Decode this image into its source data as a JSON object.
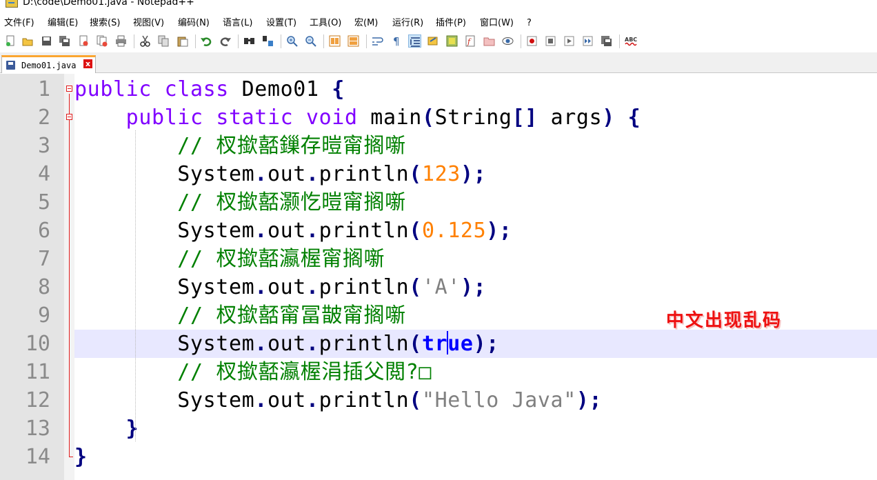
{
  "window": {
    "title": "D:\\code\\Demo01.java - Notepad++"
  },
  "menu": [
    "文件(F)",
    "编辑(E)",
    "搜索(S)",
    "视图(V)",
    "编码(N)",
    "语言(L)",
    "设置(T)",
    "工具(O)",
    "宏(M)",
    "运行(R)",
    "插件(P)",
    "窗口(W)",
    "?"
  ],
  "toolbar": {
    "icons": [
      "new-file-icon",
      "open-file-icon",
      "save-icon",
      "save-all-icon",
      "close-icon",
      "close-all-icon",
      "print-icon",
      "cut-icon",
      "copy-icon",
      "paste-icon",
      "undo-icon",
      "redo-icon",
      "find-icon",
      "replace-icon",
      "zoom-in-icon",
      "zoom-out-icon",
      "sync-vertical-icon",
      "sync-horizontal-icon",
      "word-wrap-icon",
      "show-all-chars-icon",
      "indent-guide-icon",
      "user-lang-icon",
      "doc-map-icon",
      "function-list-icon",
      "folder-workspace-icon",
      "monitor-icon",
      "record-macro-icon",
      "stop-macro-icon",
      "play-macro-icon",
      "run-macro-multiple-icon",
      "save-macro-icon",
      "spellcheck-icon"
    ],
    "spellcheck_label": "ABC"
  },
  "tabs": [
    {
      "label": "Demo01.java",
      "close": "x"
    }
  ],
  "editor": {
    "line_numbers": [
      "1",
      "2",
      "3",
      "4",
      "5",
      "6",
      "7",
      "8",
      "9",
      "10",
      "11",
      "12",
      "13",
      "14"
    ],
    "lines": [
      {
        "indent": "",
        "tokens": [
          {
            "t": "public",
            "c": "kw"
          },
          {
            "t": " "
          },
          {
            "t": "class",
            "c": "kw"
          },
          {
            "t": " Demo01 "
          },
          {
            "t": "{",
            "c": "op"
          }
        ]
      },
      {
        "indent": "    ",
        "tokens": [
          {
            "t": "public",
            "c": "kw"
          },
          {
            "t": " "
          },
          {
            "t": "static",
            "c": "kw"
          },
          {
            "t": " "
          },
          {
            "t": "void",
            "c": "kw"
          },
          {
            "t": " main"
          },
          {
            "t": "(",
            "c": "op"
          },
          {
            "t": "String"
          },
          {
            "t": "[]",
            "c": "op"
          },
          {
            "t": " args"
          },
          {
            "t": ")",
            "c": "op"
          },
          {
            "t": " "
          },
          {
            "t": "{",
            "c": "op"
          }
        ]
      },
      {
        "indent": "        ",
        "tokens": [
          {
            "t": "// 杈撳嚭鏁存暟甯搁噺",
            "c": "cm"
          }
        ]
      },
      {
        "indent": "        ",
        "tokens": [
          {
            "t": "System"
          },
          {
            "t": ".",
            "c": "op"
          },
          {
            "t": "out"
          },
          {
            "t": ".",
            "c": "op"
          },
          {
            "t": "println"
          },
          {
            "t": "(",
            "c": "op"
          },
          {
            "t": "123",
            "c": "num"
          },
          {
            "t": ");",
            "c": "op"
          }
        ]
      },
      {
        "indent": "        ",
        "tokens": [
          {
            "t": "// 杈撳嚭灏忔暟甯搁噺",
            "c": "cm"
          }
        ]
      },
      {
        "indent": "        ",
        "tokens": [
          {
            "t": "System"
          },
          {
            "t": ".",
            "c": "op"
          },
          {
            "t": "out"
          },
          {
            "t": ".",
            "c": "op"
          },
          {
            "t": "println"
          },
          {
            "t": "(",
            "c": "op"
          },
          {
            "t": "0.125",
            "c": "num"
          },
          {
            "t": ");",
            "c": "op"
          }
        ]
      },
      {
        "indent": "        ",
        "tokens": [
          {
            "t": "// 杈撳嚭瀛楃甯搁噺",
            "c": "cm"
          }
        ]
      },
      {
        "indent": "        ",
        "tokens": [
          {
            "t": "System"
          },
          {
            "t": ".",
            "c": "op"
          },
          {
            "t": "out"
          },
          {
            "t": ".",
            "c": "op"
          },
          {
            "t": "println"
          },
          {
            "t": "(",
            "c": "op"
          },
          {
            "t": "'A'",
            "c": "str"
          },
          {
            "t": ");",
            "c": "op"
          }
        ]
      },
      {
        "indent": "        ",
        "tokens": [
          {
            "t": "// 杈撳嚭甯冨皵甯搁噺",
            "c": "cm"
          }
        ]
      },
      {
        "indent": "        ",
        "current": true,
        "tokens": [
          {
            "t": "System"
          },
          {
            "t": ".",
            "c": "op"
          },
          {
            "t": "out"
          },
          {
            "t": ".",
            "c": "op"
          },
          {
            "t": "println"
          },
          {
            "t": "(",
            "c": "op"
          },
          {
            "t": "tr",
            "c": "kw2"
          },
          {
            "caret": true
          },
          {
            "t": "ue",
            "c": "kw2"
          },
          {
            "t": ");",
            "c": "op"
          }
        ]
      },
      {
        "indent": "        ",
        "tokens": [
          {
            "t": "// 杈撳嚭瀛楃涓插父閲?□",
            "c": "cm"
          }
        ]
      },
      {
        "indent": "        ",
        "tokens": [
          {
            "t": "System"
          },
          {
            "t": ".",
            "c": "op"
          },
          {
            "t": "out"
          },
          {
            "t": ".",
            "c": "op"
          },
          {
            "t": "println"
          },
          {
            "t": "(",
            "c": "op"
          },
          {
            "t": "\"Hello Java\"",
            "c": "str"
          },
          {
            "t": ");",
            "c": "op"
          }
        ]
      },
      {
        "indent": "    ",
        "tokens": [
          {
            "t": "}",
            "c": "op"
          }
        ]
      },
      {
        "indent": "",
        "tokens": [
          {
            "t": "}",
            "c": "op"
          }
        ]
      }
    ]
  },
  "annotation": "中文出现乱码",
  "colors": {
    "keyword": "#8000ff",
    "operator": "#000080",
    "number": "#ff8000",
    "string": "#808080",
    "comment": "#008000",
    "current_line": "#e8e8ff",
    "annotation": "#e11111"
  }
}
